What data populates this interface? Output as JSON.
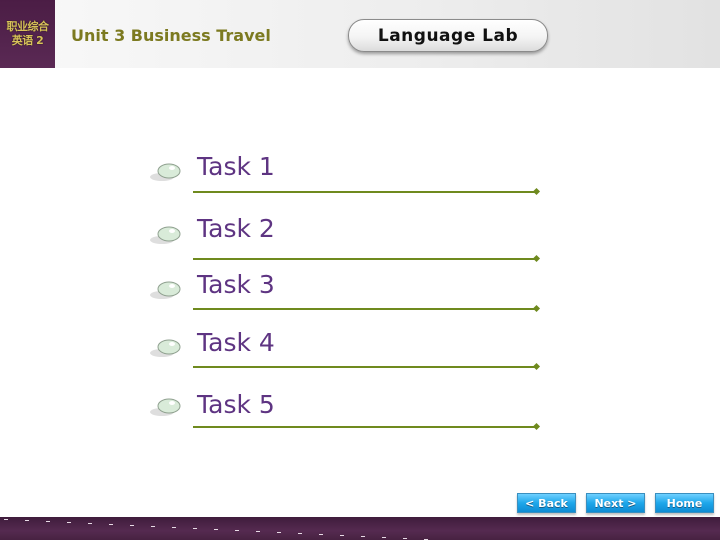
{
  "header": {
    "logo_line1": "职业综合",
    "logo_line2": "英语 2",
    "unit_title": "Unit 3 Business Travel",
    "section_button": "Language Lab"
  },
  "tasks": [
    {
      "label": "Task 1"
    },
    {
      "label": "Task 2"
    },
    {
      "label": "Task 3"
    },
    {
      "label": "Task 4"
    },
    {
      "label": "Task 5"
    }
  ],
  "nav": {
    "back": "< Back",
    "next": "Next >",
    "home": "Home"
  },
  "colors": {
    "brand_purple": "#4b1d45",
    "title_olive": "#7c7a20",
    "task_purple": "#5e3482",
    "rule_green": "#6f8a1e",
    "nav_blue": "#1ea7ea"
  }
}
